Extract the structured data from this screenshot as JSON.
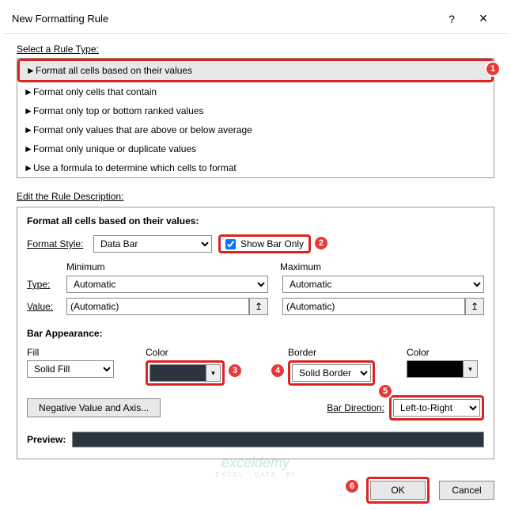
{
  "titlebar": {
    "title": "New Formatting Rule",
    "help": "?",
    "close": "×"
  },
  "select_rule_label": "Select a Rule Type:",
  "rule_types": [
    "Format all cells based on their values",
    "Format only cells that contain",
    "Format only top or bottom ranked values",
    "Format only values that are above or below average",
    "Format only unique or duplicate values",
    "Use a formula to determine which cells to format"
  ],
  "edit_desc_label": "Edit the Rule Description:",
  "desc": {
    "header": "Format all cells based on their values:",
    "format_style_label": "Format Style:",
    "format_style_value": "Data Bar",
    "show_bar_only_label": "Show Bar Only",
    "minimum_label": "Minimum",
    "maximum_label": "Maximum",
    "type_label": "Type:",
    "value_label": "Value:",
    "type_min": "Automatic",
    "type_max": "Automatic",
    "value_min": "(Automatic)",
    "value_max": "(Automatic)"
  },
  "appearance": {
    "header": "Bar Appearance:",
    "fill_label": "Fill",
    "fill_value": "Solid Fill",
    "color_label": "Color",
    "fill_color": "#2a3540",
    "border_label": "Border",
    "border_value": "Solid Border",
    "border_color_label": "Color",
    "border_color": "#000000",
    "negative_btn": "Negative Value and Axis...",
    "direction_label": "Bar Direction:",
    "direction_value": "Left-to-Right",
    "preview_label": "Preview:"
  },
  "footer": {
    "ok": "OK",
    "cancel": "Cancel"
  },
  "badges": {
    "b1": "1",
    "b2": "2",
    "b3": "3",
    "b4": "4",
    "b5": "5",
    "b6": "6"
  },
  "watermark": {
    "line1": "exceldemy",
    "line2": "EXCEL · DATA · BI"
  }
}
